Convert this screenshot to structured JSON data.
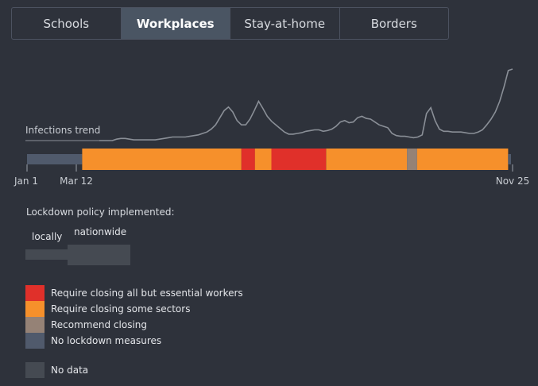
{
  "tabs": [
    {
      "label": "Schools",
      "active": false
    },
    {
      "label": "Workplaces",
      "active": true
    },
    {
      "label": "Stay-at-home",
      "active": false
    },
    {
      "label": "Borders",
      "active": false
    }
  ],
  "chart": {
    "trend_label": "Infections trend",
    "date_labels": {
      "start": "Jan 1",
      "policy_start": "Mar 12",
      "end": "Nov 25"
    }
  },
  "chart_data": {
    "type": "area",
    "series": [
      {
        "values": [
          0.0,
          0.0,
          0.0,
          0.0,
          0.02,
          0.03,
          0.03,
          0.02,
          0.01,
          0.01,
          0.01,
          0.01,
          0.01,
          0.01,
          0.02,
          0.03,
          0.04,
          0.05,
          0.05,
          0.05,
          0.05,
          0.06,
          0.07,
          0.08,
          0.1,
          0.12,
          0.16,
          0.22,
          0.32,
          0.42,
          0.47,
          0.4,
          0.28,
          0.22,
          0.22,
          0.3,
          0.42,
          0.55,
          0.45,
          0.34,
          0.27,
          0.22,
          0.17,
          0.12,
          0.09,
          0.09,
          0.1,
          0.11,
          0.13,
          0.14,
          0.15,
          0.15,
          0.13,
          0.14,
          0.16,
          0.2,
          0.26,
          0.28,
          0.25,
          0.26,
          0.32,
          0.34,
          0.31,
          0.3,
          0.26,
          0.22,
          0.2,
          0.18,
          0.1,
          0.07,
          0.06,
          0.06,
          0.05,
          0.04,
          0.05,
          0.08,
          0.38,
          0.46,
          0.28,
          0.16,
          0.13,
          0.13,
          0.12,
          0.12,
          0.12,
          0.11,
          0.1,
          0.1,
          0.12,
          0.15,
          0.22,
          0.3,
          0.4,
          0.55,
          0.75,
          0.98,
          1.0
        ]
      }
    ]
  },
  "policy_timeline": [
    {
      "level": "none",
      "start": 0.0,
      "end": 0.114
    },
    {
      "level": "some",
      "start": 0.114,
      "end": 0.443
    },
    {
      "level": "all_but_essential",
      "start": 0.443,
      "end": 0.471
    },
    {
      "level": "some",
      "start": 0.471,
      "end": 0.505
    },
    {
      "level": "all_but_essential",
      "start": 0.505,
      "end": 0.618
    },
    {
      "level": "some",
      "start": 0.618,
      "end": 0.785
    },
    {
      "level": "recommend",
      "start": 0.785,
      "end": 0.806
    },
    {
      "level": "some",
      "start": 0.806,
      "end": 0.994
    },
    {
      "level": "none",
      "start": 0.994,
      "end": 1.0
    }
  ],
  "scope": {
    "title": "Lockdown policy implemented:",
    "locally": "locally",
    "nationwide": "nationwide"
  },
  "legend": [
    {
      "key": "all_but_essential",
      "label": "Require closing all but essential workers",
      "color": "#e0302a"
    },
    {
      "key": "some",
      "label": "Require closing some sectors",
      "color": "#f6902b"
    },
    {
      "key": "recommend",
      "label": "Recommend closing",
      "color": "#958276"
    },
    {
      "key": "none",
      "label": "No lockdown measures",
      "color": "#505a6c"
    }
  ],
  "no_data": {
    "label": "No data",
    "color": "#454a52"
  },
  "colors": {
    "background": "#2e323b",
    "trend_line": "#8a8f97",
    "tick": "#9aa0a8"
  }
}
